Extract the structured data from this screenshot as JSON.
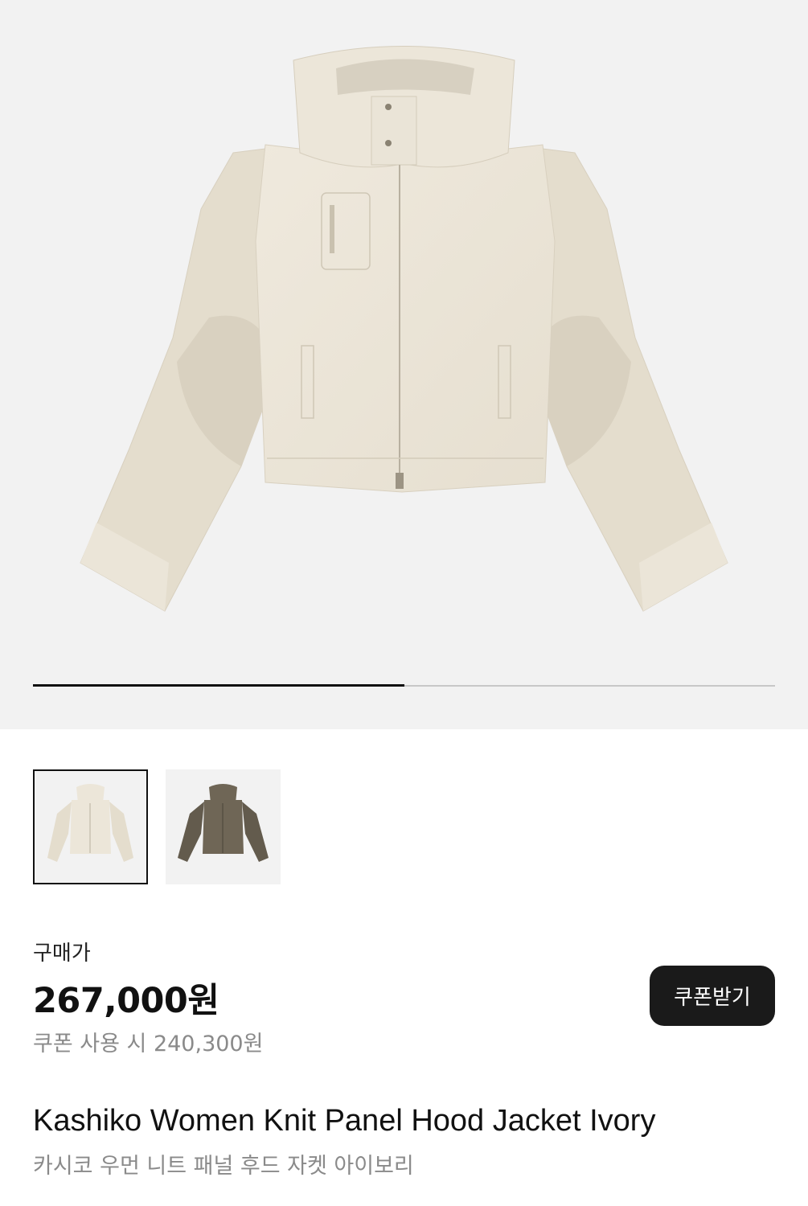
{
  "gallery": {
    "main_image": "ivory-hood-jacket-photo",
    "progress_fraction": 0.5,
    "thumbnails": [
      {
        "name": "ivory-jacket-thumbnail",
        "color": "#ece6d9",
        "selected": true
      },
      {
        "name": "khaki-jacket-thumbnail",
        "color": "#6f6656",
        "selected": false
      }
    ]
  },
  "pricing": {
    "label": "구매가",
    "price": "267,000원",
    "coupon_price": "쿠폰 사용 시 240,300원",
    "coupon_button": "쿠폰받기"
  },
  "product": {
    "name_en": "Kashiko Women Knit Panel Hood Jacket Ivory",
    "name_ko": "카시코 우먼 니트 패널 후드 자켓 아이보리"
  },
  "colors": {
    "ivory": "#ece6d9",
    "ivory_sleeve": "#e3dccd",
    "khaki": "#6f6656",
    "accent_dark": "#1a1a1a"
  }
}
